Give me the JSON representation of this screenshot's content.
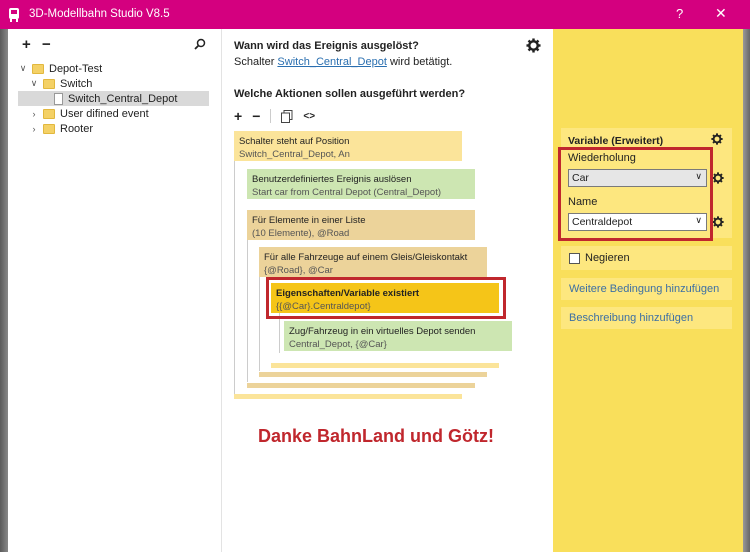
{
  "window": {
    "title": "3D-Modellbahn Studio V8.5",
    "help_label": "?",
    "close_label": "✕"
  },
  "tree": {
    "toolbar": {
      "add_label": "+",
      "remove_label": "−"
    },
    "nodes": [
      {
        "label": "Depot-Test",
        "chevron": "∨"
      },
      {
        "label": "Switch",
        "chevron": "∨"
      },
      {
        "label": "Switch_Central_Depot",
        "chevron": ""
      },
      {
        "label": "User difined event",
        "chevron": "›"
      },
      {
        "label": "Rooter",
        "chevron": "›"
      }
    ]
  },
  "trigger": {
    "question": "Wann wird das Ereignis ausgelöst?",
    "prefix": "Schalter",
    "link": "Switch_Central_Depot",
    "suffix": "wird betätigt."
  },
  "actions": {
    "question": "Welche Aktionen sollen ausgeführt werden?",
    "toolbar": {
      "add_label": "+",
      "remove_label": "−",
      "code_label": "<>"
    },
    "blocks": [
      {
        "title": "Schalter steht auf Position",
        "detail": "Switch_Central_Depot, An"
      },
      {
        "title": "Benutzerdefiniertes Ereignis auslösen",
        "detail": "Start car from Central Depot (Central_Depot)"
      },
      {
        "title": "Für Elemente in einer Liste",
        "detail": "(10 Elemente), @Road"
      },
      {
        "title": "Für alle Fahrzeuge auf einem Gleis/Gleiskontakt",
        "detail": "{@Road}, @Car"
      },
      {
        "title": "Eigenschaften/Variable existiert",
        "detail": "{{@Car}.Centraldepot}"
      },
      {
        "title": "Zug/Fahrzeug in ein virtuelles Depot senden",
        "detail": "Central_Depot, {@Car}"
      }
    ]
  },
  "thanks_text": "Danke BahnLand und Götz!",
  "condition": {
    "header": "Variable (Erweitert)",
    "repeat_label": "Wiederholung",
    "repeat_value": "Car",
    "name_label": "Name",
    "name_value": "Centraldepot",
    "negate_label": "Negieren",
    "add_condition_label": "Weitere Bedingung hinzufügen",
    "add_description_label": "Beschreibung hinzufügen"
  },
  "colors": {
    "titlebar": "#d4007f",
    "highlight": "#c0272d",
    "panel": "#f9df5b"
  }
}
